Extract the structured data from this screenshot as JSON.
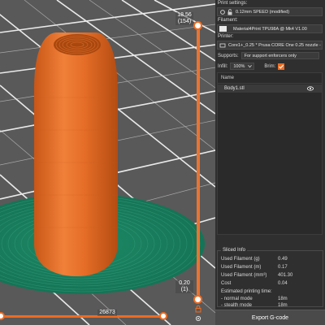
{
  "colors": {
    "accent": "#ed6b21",
    "object": "#e8742c",
    "brim": "#1f8a67",
    "bed": "#595959",
    "panel": "#2f2f2f"
  },
  "viewport": {
    "layer_slider": {
      "top_height": "18.56",
      "top_layer": "(154)",
      "bottom_height": "0.20",
      "bottom_layer": "(1)"
    },
    "move_slider": {
      "value": "26873"
    }
  },
  "panel": {
    "print_settings": {
      "label": "Print settings:",
      "value": "0.12mm SPEED (modified)"
    },
    "filament": {
      "label": "Filament:",
      "value": "Material4Print TPU98A @ Mk4 V1.00"
    },
    "printer": {
      "label": "Printer:",
      "value": "Core1+_0.25 * Prusa CORE One 0.25 nozzle -"
    },
    "supports": {
      "label": "Supports:",
      "value": "For support enforcers only"
    },
    "infill": {
      "label": "Infill:",
      "value": "100%"
    },
    "brim": {
      "label": "Brim:",
      "checked": true
    },
    "object_list": {
      "header": "Name",
      "items": [
        {
          "name": "Body1.stl"
        }
      ]
    },
    "sliced_info": {
      "title": "Sliced Info",
      "rows": [
        {
          "label": "Used Filament (g)",
          "value": "0.49"
        },
        {
          "label": "Used Filament (m)",
          "value": "0.17"
        },
        {
          "label": "Used Filament (mm³)",
          "value": "401.30"
        },
        {
          "label": "Cost",
          "value": "0.04"
        }
      ],
      "time_title": "Estimated printing time:",
      "time_rows": [
        {
          "label": "- normal mode",
          "value": "18m"
        },
        {
          "label": "- stealth mode",
          "value": "18m"
        }
      ]
    },
    "export_label": "Export G-code"
  }
}
